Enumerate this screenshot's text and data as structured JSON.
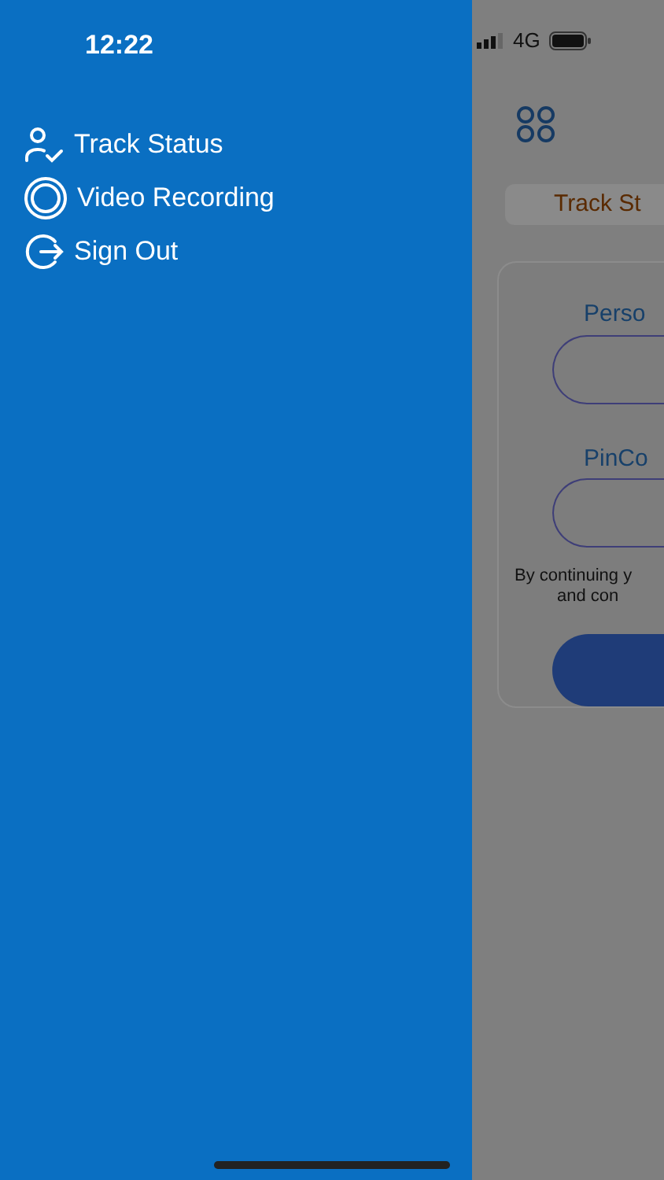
{
  "status_bar": {
    "time": "12:22",
    "network": "4G"
  },
  "drawer": {
    "items": [
      {
        "kind": "track",
        "label": "Track Status"
      },
      {
        "kind": "video",
        "label": "Video Recording"
      },
      {
        "kind": "signout",
        "label": "Sign Out"
      }
    ]
  },
  "background_page": {
    "track_button": "Track St",
    "form": {
      "fields": [
        {
          "label": "Perso"
        },
        {
          "label": "PinCo"
        }
      ],
      "terms": [
        "By continuing y",
        "and con"
      ]
    }
  }
}
